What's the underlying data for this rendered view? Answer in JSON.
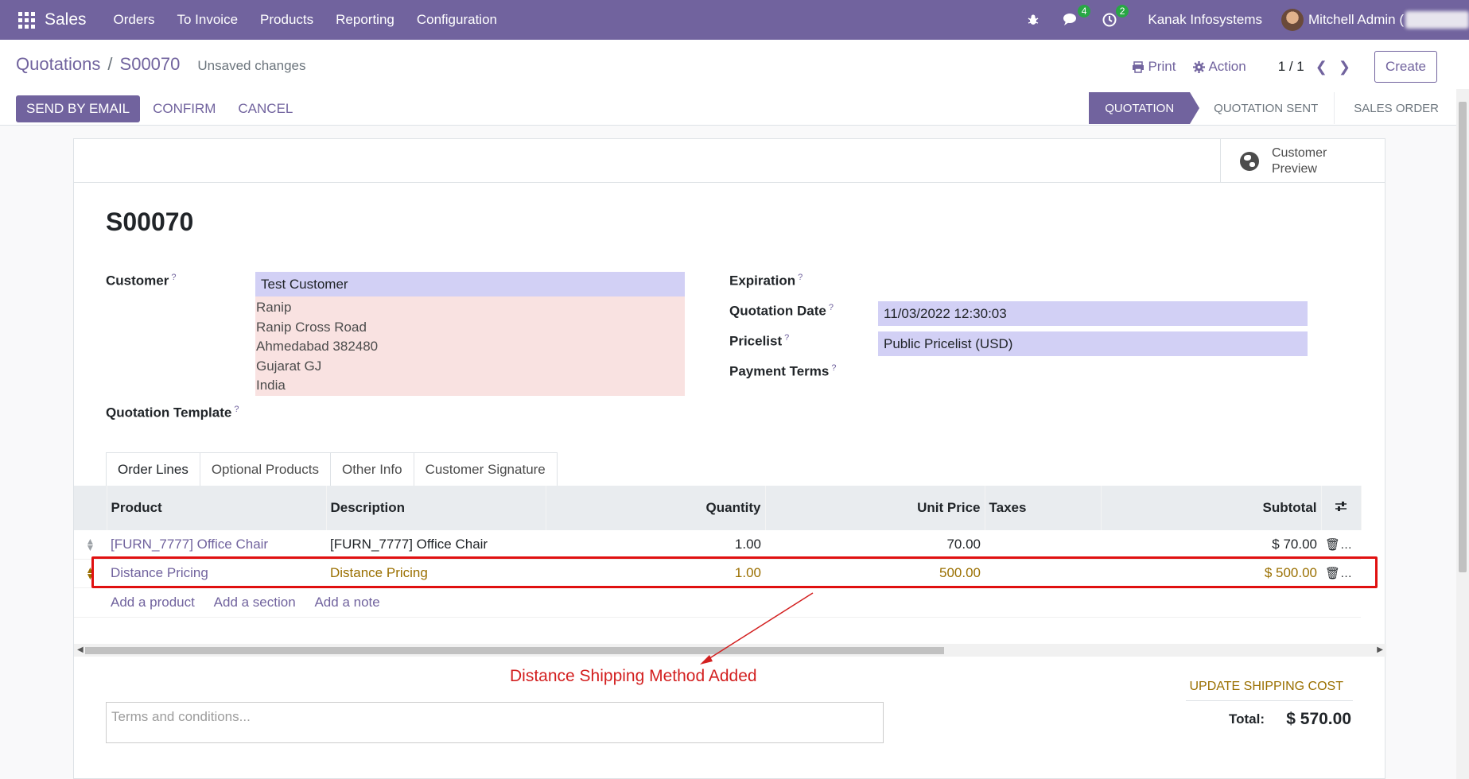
{
  "navbar": {
    "app_name": "Sales",
    "menu": [
      "Orders",
      "To Invoice",
      "Products",
      "Reporting",
      "Configuration"
    ],
    "messages_count": "4",
    "activities_count": "2",
    "company": "Kanak Infosystems",
    "user": "Mitchell Admin ("
  },
  "control": {
    "breadcrumb_parent": "Quotations",
    "breadcrumb_sep": "/",
    "breadcrumb_current": "S00070",
    "unsaved": "Unsaved changes",
    "print": "Print",
    "action": "Action",
    "pager": "1 / 1",
    "create": "Create",
    "send_email": "SEND BY EMAIL",
    "confirm": "CONFIRM",
    "cancel": "CANCEL",
    "steps": [
      "QUOTATION",
      "QUOTATION SENT",
      "SALES ORDER"
    ]
  },
  "sheet": {
    "customer_preview": "Customer Preview",
    "record_name": "S00070",
    "labels": {
      "customer": "Customer",
      "quotation_template": "Quotation Template",
      "expiration": "Expiration",
      "quotation_date": "Quotation Date",
      "pricelist": "Pricelist",
      "payment_terms": "Payment Terms"
    },
    "help_mark": "?",
    "customer_name": "Test Customer",
    "address": [
      "Ranip",
      "Ranip Cross Road",
      "Ahmedabad 382480",
      "Gujarat GJ",
      "India"
    ],
    "quotation_date": "11/03/2022 12:30:03",
    "pricelist": "Public Pricelist (USD)",
    "tabs": [
      "Order Lines",
      "Optional Products",
      "Other Info",
      "Customer Signature"
    ],
    "columns": [
      "Product",
      "Description",
      "Quantity",
      "Unit Price",
      "Taxes",
      "Subtotal"
    ],
    "lines": [
      {
        "product": "[FURN_7777] Office Chair",
        "description": "[FURN_7777] Office Chair",
        "quantity": "1.00",
        "unit_price": "70.00",
        "taxes": "",
        "subtotal": "$ 70.00"
      },
      {
        "product": "Distance Pricing",
        "description": "Distance Pricing",
        "quantity": "1.00",
        "unit_price": "500.00",
        "taxes": "",
        "subtotal": "$ 500.00"
      }
    ],
    "add_product": "Add a product",
    "add_section": "Add a section",
    "add_note": "Add a note",
    "annotation": "Distance Shipping Method Added",
    "terms_placeholder": "Terms and conditions...",
    "update_shipping": "UPDATE SHIPPING COST",
    "total_label": "Total:",
    "total_value": "$ 570.00"
  },
  "colors": {
    "brand": "#71639e",
    "highlight": "#e01010",
    "annotation": "#d32020"
  }
}
